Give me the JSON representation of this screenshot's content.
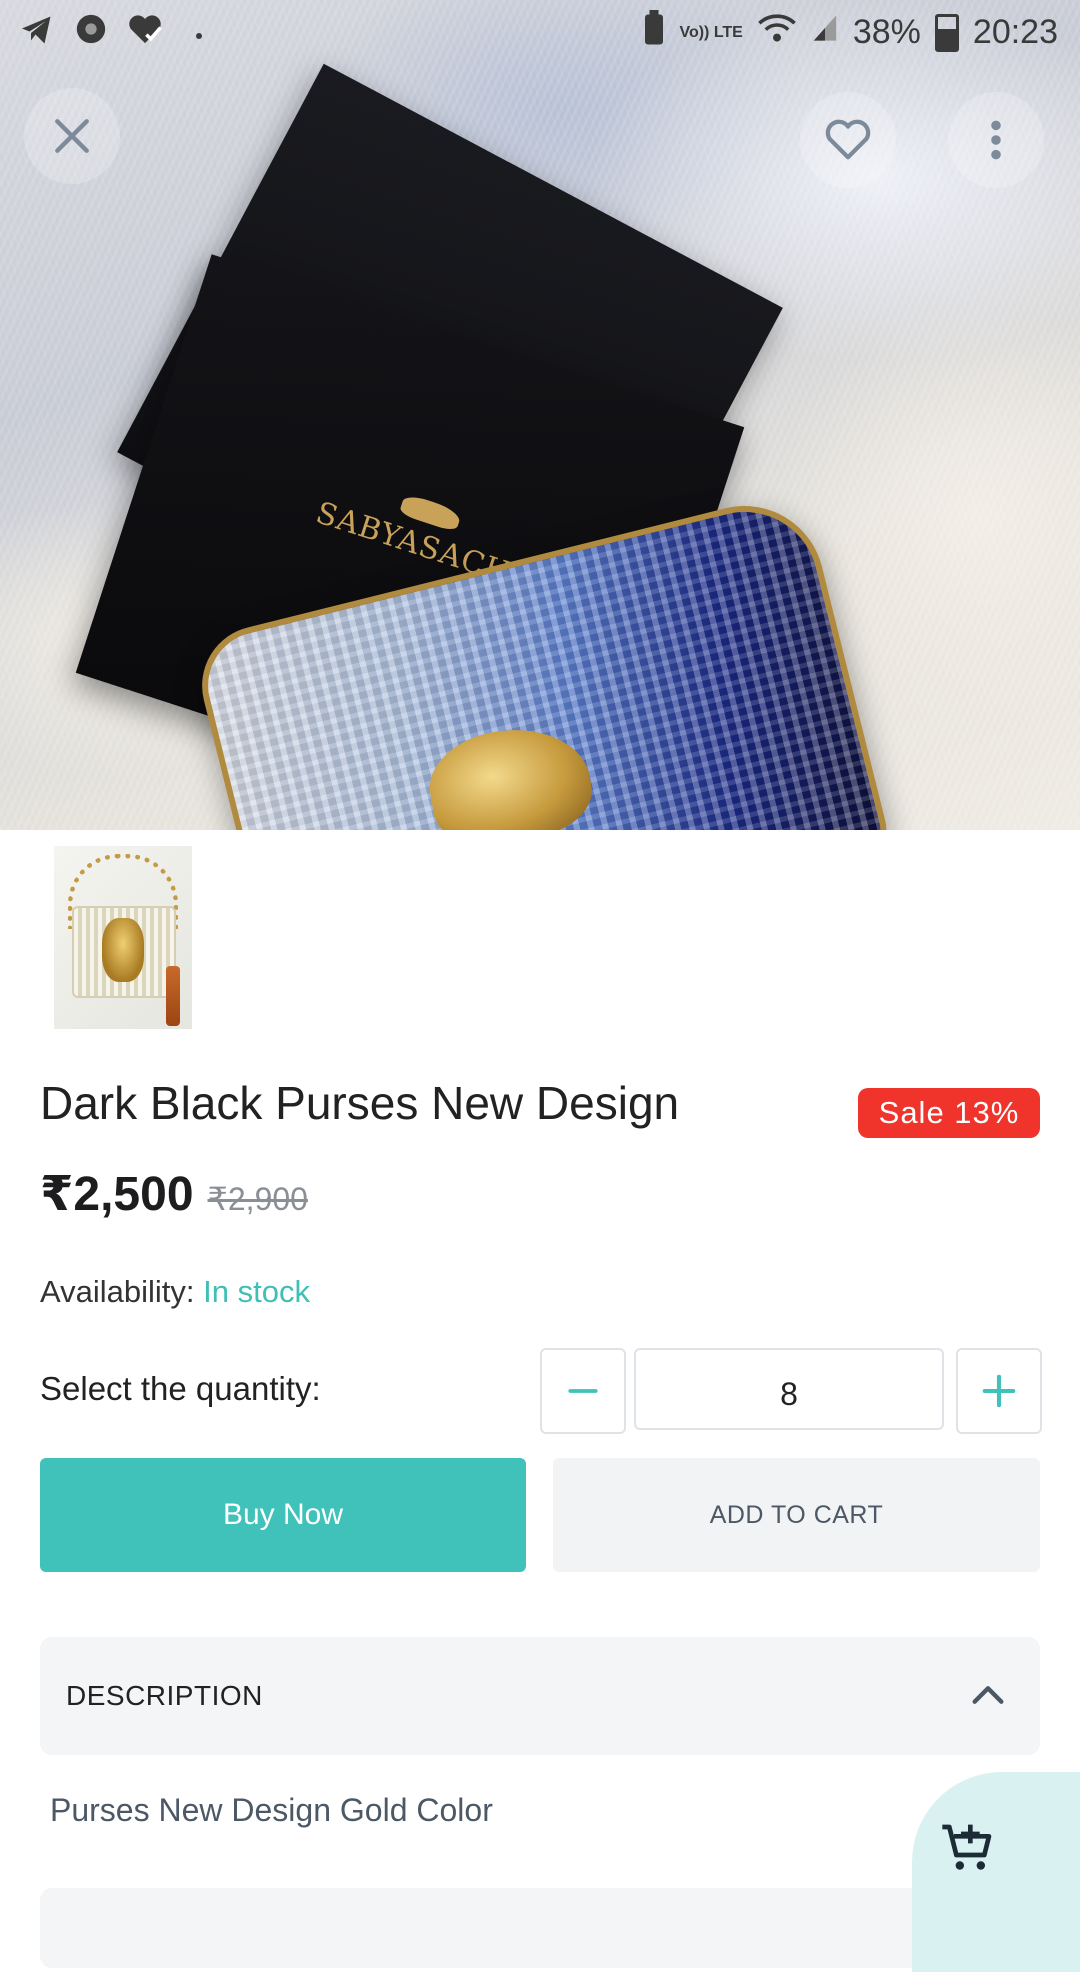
{
  "status_bar": {
    "battery_percent": "38%",
    "time": "20:23",
    "network_label": "Vo)) LTE",
    "left_icons": [
      "telegram-icon",
      "app-icon",
      "heart-check-icon",
      "dot-icon"
    ],
    "right_icons": [
      "battery-saver-icon",
      "lte-icon",
      "wifi-icon",
      "signal-icon",
      "battery-icon"
    ]
  },
  "hero": {
    "brand_text": "SABYASACHI",
    "icons": {
      "close": "close-icon",
      "wishlist": "heart-outline-icon",
      "more": "more-vertical-icon"
    }
  },
  "gallery": {
    "thumbnails": [
      {
        "name": "purse-thumbnail"
      }
    ]
  },
  "product": {
    "title": "Dark Black Purses New Design",
    "sale_badge": "Sale 13%",
    "price": "₹2,500",
    "old_price": "₹2,900",
    "availability_label": "Availability:",
    "availability_value": "In stock"
  },
  "quantity": {
    "label": "Select the quantity:",
    "value": "8",
    "minus_icon": "minus-icon",
    "plus_icon": "plus-icon"
  },
  "actions": {
    "buy_now": "Buy Now",
    "add_to_cart": "ADD TO CART"
  },
  "description": {
    "title": "DESCRIPTION",
    "text": "Purses New Design Gold Color",
    "chevron_icon": "chevron-up-icon"
  },
  "fab": {
    "icon": "add-to-cart-icon"
  },
  "colors": {
    "accent": "#40c1ba",
    "sale": "#f0332b",
    "stock": "#3fbfb6",
    "panel": "#f4f5f7"
  }
}
